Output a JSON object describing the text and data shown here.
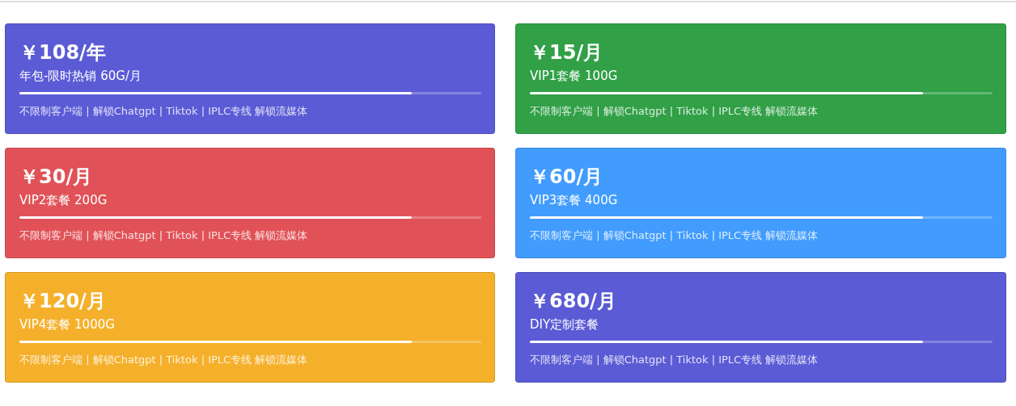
{
  "plans": [
    {
      "price": "￥108/年",
      "name": "年包-限时热销 60G/月",
      "level": 0.85,
      "features": "不限制客户端 | 解锁Chatgpt | Tiktok | IPLC专线 解锁流媒体",
      "color": "#5b5bd6"
    },
    {
      "price": "￥15/月",
      "name": "VIP1套餐 100G",
      "level": 0.85,
      "features": "不限制客户端 | 解锁Chatgpt | Tiktok | IPLC专线 解锁流媒体",
      "color": "#31a047"
    },
    {
      "price": "￥30/月",
      "name": "VIP2套餐 200G",
      "level": 0.85,
      "features": "不限制客户端 | 解锁Chatgpt | Tiktok | IPLC专线 解锁流媒体",
      "color": "#e05257"
    },
    {
      "price": "￥60/月",
      "name": "VIP3套餐 400G",
      "level": 0.85,
      "features": "不限制客户端 | 解锁Chatgpt | Tiktok | IPLC专线 解锁流媒体",
      "color": "#419cfd"
    },
    {
      "price": "￥120/月",
      "name": "VIP4套餐 1000G",
      "level": 0.85,
      "features": "不限制客户端 | 解锁Chatgpt | Tiktok | IPLC专线 解锁流媒体",
      "color": "#f5b02b"
    },
    {
      "price": "￥680/月",
      "name": "DIY定制套餐",
      "level": 0.85,
      "features": "不限制客户端 | 解锁Chatgpt | Tiktok | IPLC专线 解锁流媒体",
      "color": "#5b5bd6"
    }
  ]
}
